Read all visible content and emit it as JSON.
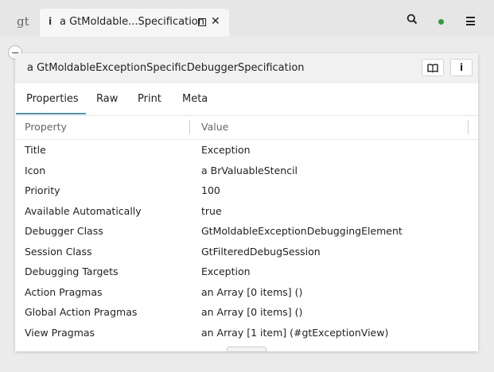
{
  "topbar": {
    "logo": "gt",
    "tab": {
      "icon_label": "i",
      "title": "a GtMoldable...Specification"
    },
    "icons": [
      "search-icon",
      "status-dot",
      "menu-icon"
    ],
    "status_color": "#2ea043"
  },
  "panel": {
    "title": "a GtMoldableExceptionSpecificDebuggerSpecification",
    "buttons": [
      "book-icon",
      "info-icon"
    ],
    "info_label": "i",
    "tabs": [
      "Properties",
      "Raw",
      "Print",
      "Meta"
    ],
    "active_tab": "Properties",
    "accent_color": "#4a90c8",
    "columns": [
      "Property",
      "Value"
    ],
    "rows": [
      {
        "property": "Title",
        "value": "Exception"
      },
      {
        "property": "Icon",
        "value": "a BrValuableStencil"
      },
      {
        "property": "Priority",
        "value": "100"
      },
      {
        "property": "Available Automatically",
        "value": "true"
      },
      {
        "property": "Debugger Class",
        "value": "GtMoldableExceptionDebuggingElement"
      },
      {
        "property": "Session Class",
        "value": "GtFilteredDebugSession"
      },
      {
        "property": "Debugging Targets",
        "value": "Exception"
      },
      {
        "property": "Action Pragmas",
        "value": "an Array [0 items] ()"
      },
      {
        "property": "Global Action Pragmas",
        "value": "an Array [0 items] ()"
      },
      {
        "property": "View Pragmas",
        "value": "an Array [1 item] (#gtExceptionView)"
      }
    ]
  }
}
